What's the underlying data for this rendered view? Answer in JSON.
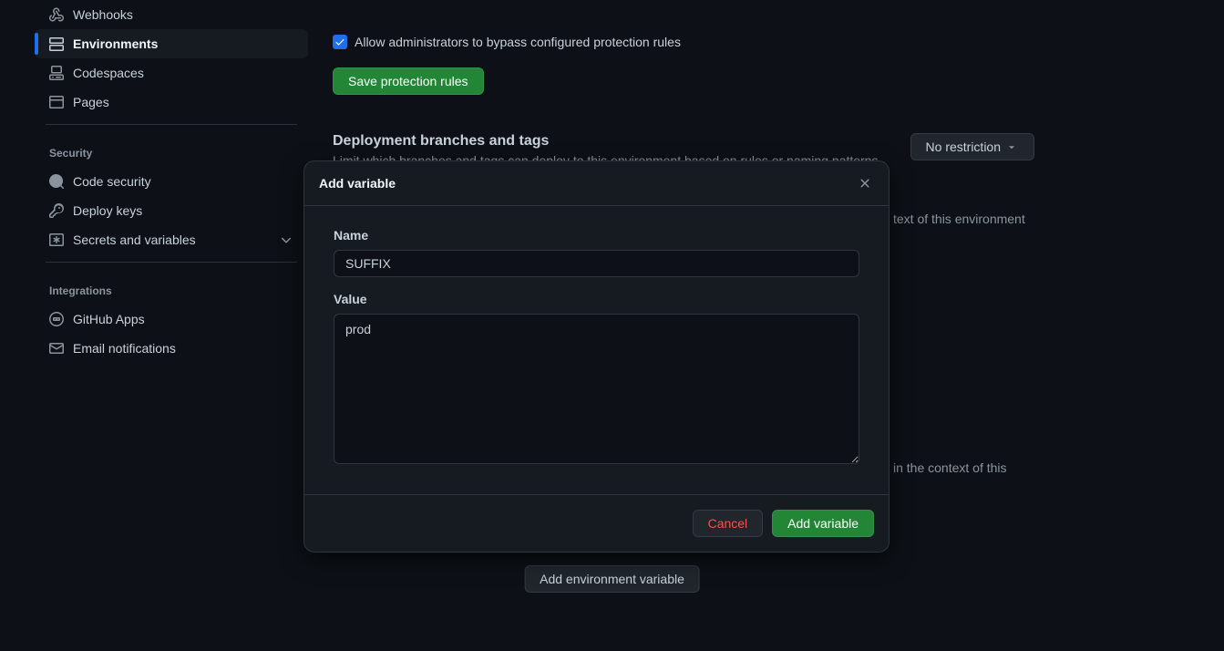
{
  "sidebar": {
    "items": [
      {
        "label": "Webhooks"
      },
      {
        "label": "Environments"
      },
      {
        "label": "Codespaces"
      },
      {
        "label": "Pages"
      }
    ],
    "security_heading": "Security",
    "security_items": [
      {
        "label": "Code security"
      },
      {
        "label": "Deploy keys"
      },
      {
        "label": "Secrets and variables"
      }
    ],
    "integrations_heading": "Integrations",
    "integrations_items": [
      {
        "label": "GitHub Apps"
      },
      {
        "label": "Email notifications"
      }
    ]
  },
  "main": {
    "bypass_label": "Allow administrators to bypass configured protection rules",
    "save_rules_label": "Save protection rules",
    "branches_title": "Deployment branches and tags",
    "branches_desc": "Limit which branches and tags can deploy to this environment based on rules or naming patterns.",
    "no_restriction_label": "No restriction",
    "context_text_1": "text of this environment",
    "context_text_2": "in the context of this",
    "add_env_var_label": "Add environment variable"
  },
  "modal": {
    "title": "Add variable",
    "name_label": "Name",
    "name_value": "SUFFIX",
    "value_label": "Value",
    "value_value": "prod",
    "cancel_label": "Cancel",
    "submit_label": "Add variable"
  }
}
